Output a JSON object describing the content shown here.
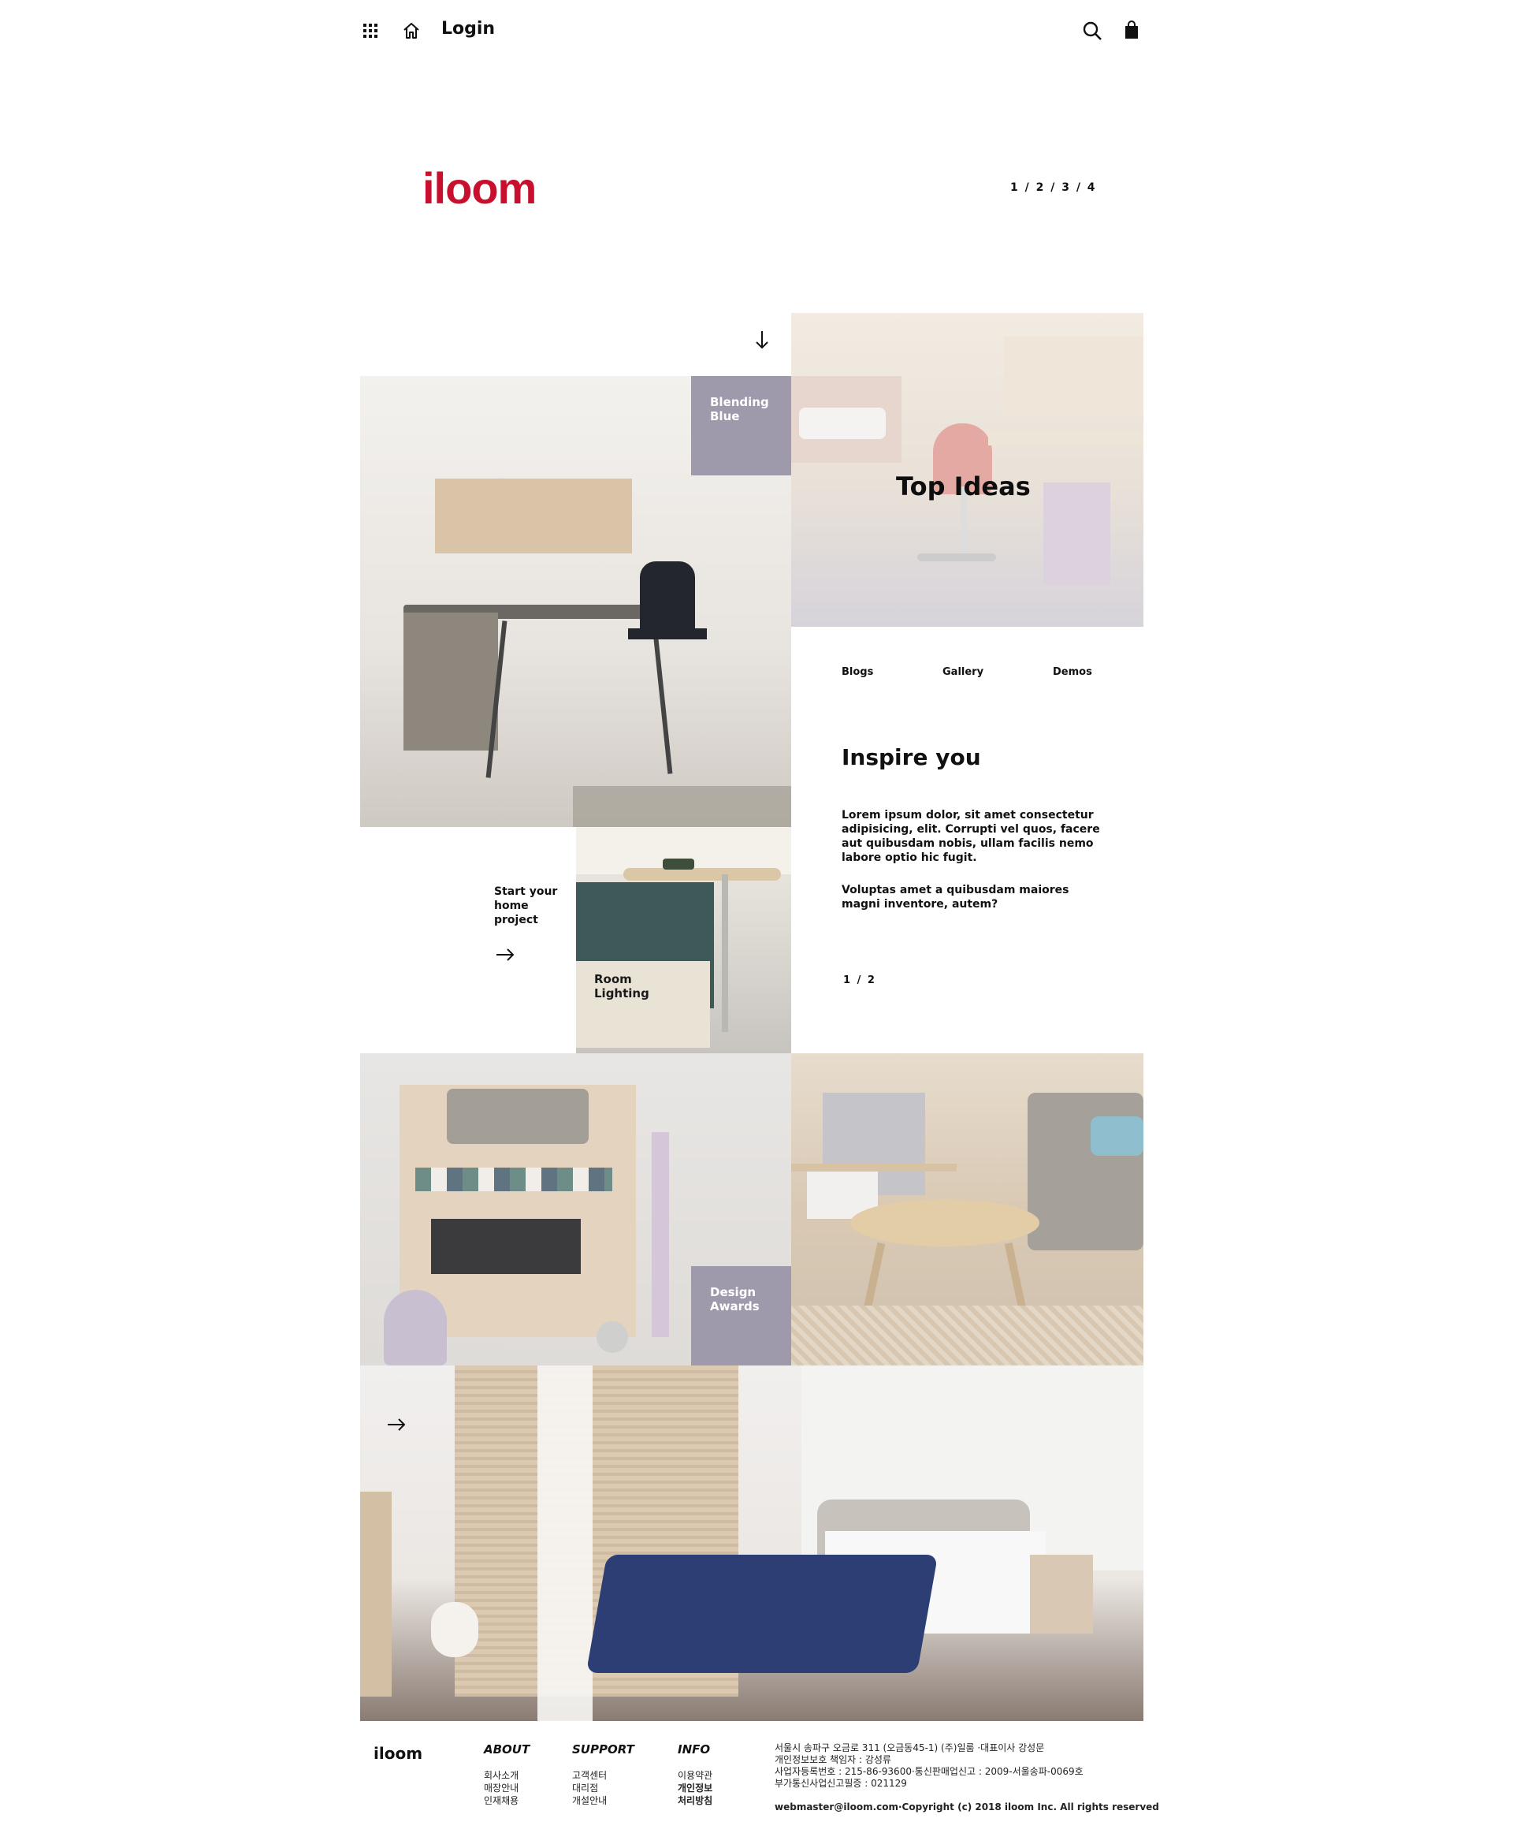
{
  "header": {
    "login_label": "Login",
    "menu_icon": "grid-menu-icon",
    "home_icon": "home-icon",
    "search_icon": "search-icon",
    "cart_icon": "shopping-bag-icon"
  },
  "brand": {
    "logo_text": "iloom",
    "color": "#c8102e",
    "pager": "1 / 2 / 3 / 4"
  },
  "tiles": {
    "blending_label": "Blending\nBlue",
    "top_ideas": "Top Ideas",
    "start_project": "Start your\nhome\nproject",
    "room_lighting": "Room\nLighting",
    "design_awards": "Design\nAwards",
    "accent_color": "#9e9aab"
  },
  "content_nav": {
    "items": [
      "Blogs",
      "Gallery",
      "Demos"
    ]
  },
  "inspire": {
    "title": "Inspire you",
    "paragraph1": "Lorem ipsum dolor, sit amet consectetur adipisicing, elit. Corrupti vel quos, facere aut quibusdam nobis, ullam facilis nemo labore optio hic fugit.",
    "paragraph2": "Voluptas amet a quibusdam maiores magni inventore, autem?",
    "pager": "1 / 2"
  },
  "footer": {
    "logo": "iloom",
    "about": {
      "heading": "ABOUT",
      "links": [
        "회사소개",
        "매장안내",
        "인재채용"
      ]
    },
    "support": {
      "heading": "SUPPORT",
      "links": [
        "고객센터",
        "대리점",
        "개설안내"
      ]
    },
    "info": {
      "heading": "INFO",
      "links": [
        "이용약관",
        "개인정보",
        "처리방침"
      ]
    },
    "address_lines": [
      "서울시 송파구 오금로 311 (오금동45-1) (주)일룸 ·대표이사 강성문",
      "개인정보보호 책임자 : 강성류",
      "사업자등록번호 : 215-86-93600·통신판매업신고 : 2009-서울송파-0069호",
      "부가통신사업신고필증 : 021129"
    ],
    "copyright": "webmaster@iloom.com·Copyright (c) 2018 iloom Inc. All rights reserved"
  }
}
